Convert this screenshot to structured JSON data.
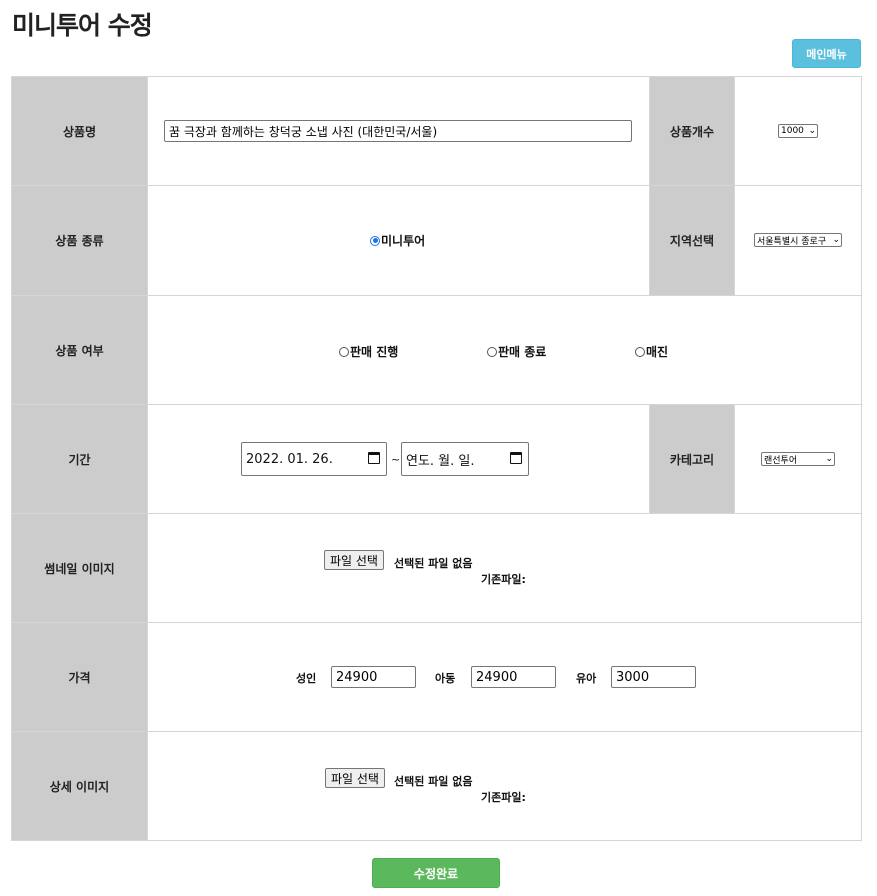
{
  "page": {
    "title": "미니투어 수정"
  },
  "header": {
    "main_menu_label": "메인메뉴"
  },
  "fields": {
    "product_name": {
      "label": "상품명",
      "value": "꿈 극장과 함께하는 창덕궁 소냅 사진 (대한민국/서울)"
    },
    "product_count": {
      "label": "상품개수",
      "selected": "1000"
    },
    "product_type": {
      "label": "상품 종류",
      "option": "미니투어",
      "checked": true
    },
    "region": {
      "label": "지역선택",
      "selected": "서울특별시 종로구"
    },
    "status": {
      "label": "상품 여부",
      "options": [
        "판매 진행",
        "판매 종료",
        "매진"
      ]
    },
    "period": {
      "label": "기간",
      "start": "2022. 01. 26.",
      "separator": "~",
      "end": "연도. 월. 일."
    },
    "category": {
      "label": "카테고리",
      "selected": "랜선투어"
    },
    "thumbnail": {
      "label": "썸네일 이미지",
      "button": "파일 선택",
      "status": "선택된 파일 없음",
      "existing": "기존파일:"
    },
    "price": {
      "label": "가격",
      "adult_label": "성인",
      "adult_value": "24900",
      "child_label": "아동",
      "child_value": "24900",
      "infant_label": "유아",
      "infant_value": "3000"
    },
    "detail_image": {
      "label": "상세 이미지",
      "button": "파일 선택",
      "status": "선택된 파일 없음",
      "existing": "기존파일:"
    }
  },
  "footer": {
    "submit_label": "수정완료"
  },
  "icons": {
    "dropdown": "chevron-down-icon",
    "calendar": "calendar-icon"
  },
  "colors": {
    "label_bg": "#cccccc",
    "menu_button": "#5bc0de",
    "submit_button": "#5cb85c"
  }
}
